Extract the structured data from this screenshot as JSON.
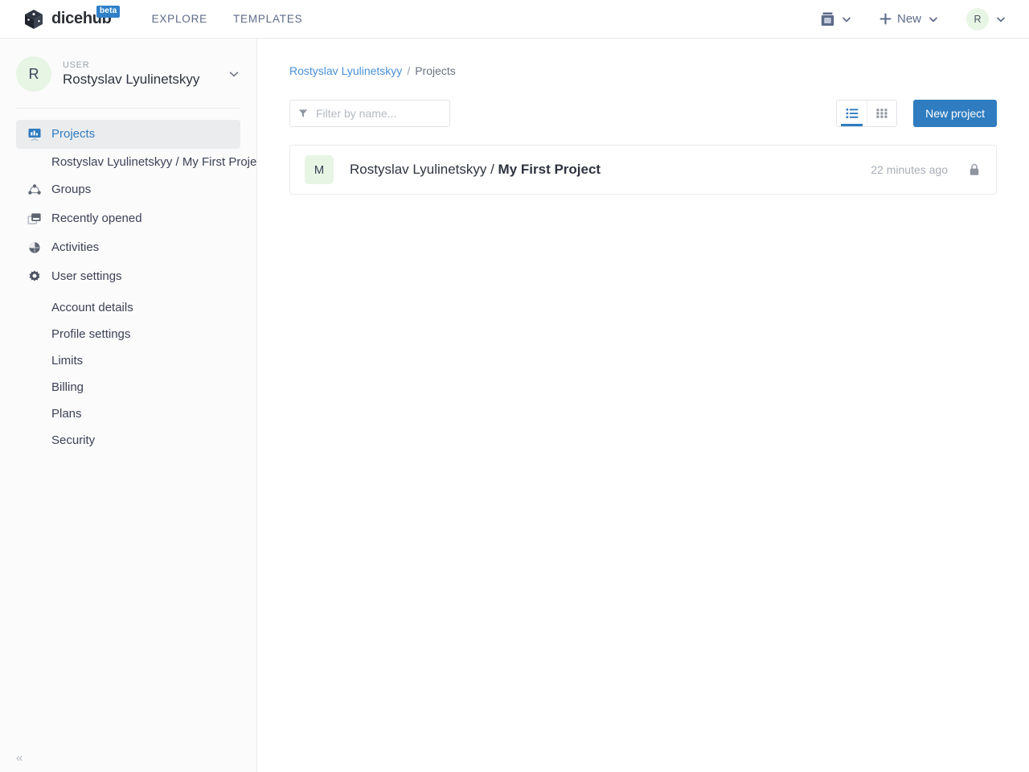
{
  "header": {
    "brand_name": "dicehub",
    "beta_badge": "beta",
    "logo_icon": "cube-icon",
    "nav": [
      {
        "label": "EXPLORE",
        "name": "nav-link-explore"
      },
      {
        "label": "TEMPLATES",
        "name": "nav-link-templates"
      }
    ],
    "storage_icon": "database-icon",
    "new_label": "New",
    "new_icon": "plus-icon",
    "avatar_initial": "R",
    "chevron_icon": "chevron-down-icon"
  },
  "sidebar": {
    "user": {
      "kicker": "USER",
      "name": "Rostyslav Lyulinetskyy",
      "avatar_initial": "R",
      "chevron_icon": "chevron-down-icon"
    },
    "items": [
      {
        "label": "Projects",
        "icon": "projects-board-icon",
        "active": true
      },
      {
        "label": "Groups",
        "icon": "groups-network-icon",
        "active": false
      },
      {
        "label": "Recently opened",
        "icon": "recent-window-icon",
        "active": false
      },
      {
        "label": "Activities",
        "icon": "activities-pie-icon",
        "active": false
      },
      {
        "label": "User settings",
        "icon": "gear-icon",
        "active": false
      }
    ],
    "project_sub_item": "Rostyslav Lyulinetskyy / My First Project",
    "settings_sub_items": [
      "Account details",
      "Profile settings",
      "Limits",
      "Billing",
      "Plans",
      "Security"
    ],
    "collapse_glyph": "«"
  },
  "main": {
    "breadcrumb": {
      "owner": "Rostyslav Lyulinetskyy",
      "separator": "/",
      "current": "Projects"
    },
    "toolbar": {
      "filter_placeholder": "Filter by name...",
      "filter_value": "",
      "filter_icon": "funnel-icon",
      "view_list_icon": "list-view-icon",
      "view_grid_icon": "grid-view-icon",
      "active_view": "list",
      "new_project_label": "New project"
    },
    "projects": [
      {
        "avatar_initial": "M",
        "owner": "Rostyslav Lyulinetskyy / ",
        "name": "My First Project",
        "updated": "22 minutes ago",
        "visibility_icon": "lock-icon"
      }
    ]
  },
  "colors": {
    "accent": "#2f7cc0",
    "link": "#4a90d9",
    "avatar_bg": "#e7f6e4",
    "sidebar_bg": "#fbfbfb",
    "border": "#e8eaed",
    "muted_text": "#a8adb7"
  }
}
